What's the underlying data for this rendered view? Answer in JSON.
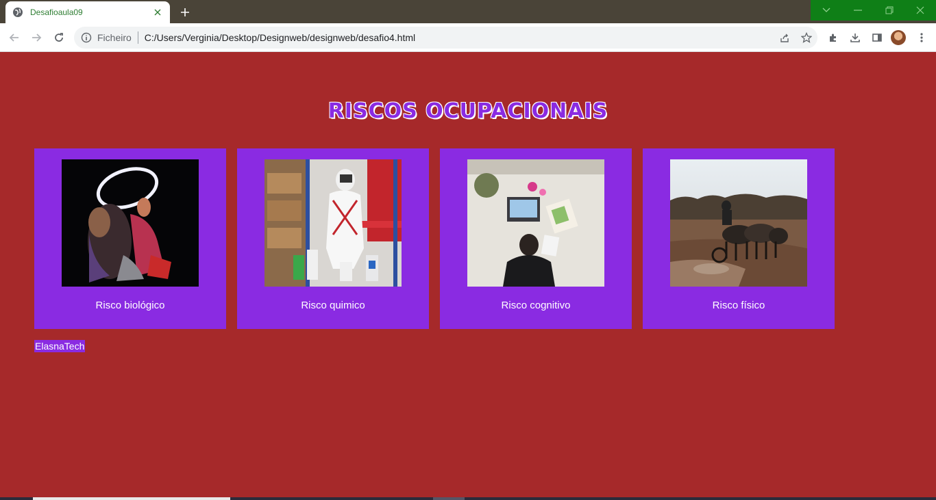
{
  "browser": {
    "tab_title": "Desafioaula09",
    "url_scheme": "Ficheiro",
    "url": "C:/Users/Verginia/Desktop/Designweb/designweb/desafio4.html"
  },
  "page": {
    "heading": "RISCOS OCUPACIONAIS",
    "cards": [
      {
        "caption": "Risco biológico",
        "image": "tattoo-artist-photo"
      },
      {
        "caption": "Risco quimico",
        "image": "hazmat-worker-photo"
      },
      {
        "caption": "Risco cognitivo",
        "image": "desk-work-photo"
      },
      {
        "caption": "Risco físico",
        "image": "horse-plough-photo"
      }
    ],
    "footer_brand": "ElasnaTech"
  },
  "colors": {
    "page_background": "#a6292a",
    "card_background": "#8a2be2",
    "window_controls": "#0f7f17",
    "tab_strip": "#4a4438"
  }
}
